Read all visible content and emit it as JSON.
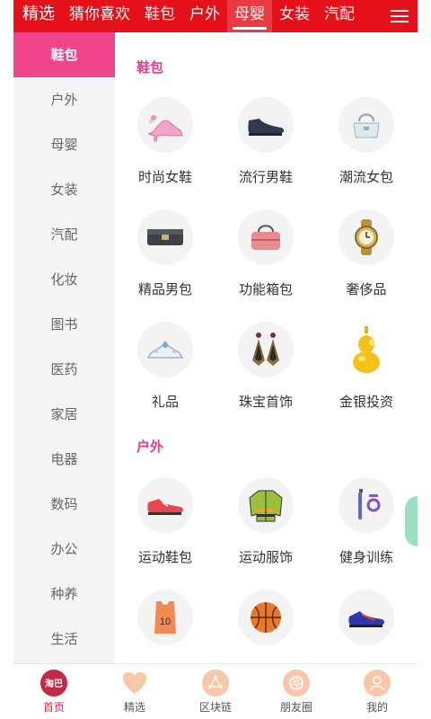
{
  "top_tabs": [
    "精选",
    "猜你喜欢",
    "鞋包",
    "户外",
    "母婴",
    "女装",
    "汽配"
  ],
  "active_tab": "母婴",
  "sidebar": [
    "鞋包",
    "户外",
    "母婴",
    "女装",
    "汽配",
    "化妆",
    "图书",
    "医药",
    "家居",
    "电器",
    "数码",
    "办公",
    "种养",
    "生活"
  ],
  "active_sidebar": "鞋包",
  "sections": [
    {
      "title": "鞋包",
      "items": [
        {
          "label": "时尚女鞋",
          "icon": "high-heel-icon"
        },
        {
          "label": "流行男鞋",
          "icon": "mens-shoe-icon"
        },
        {
          "label": "潮流女包",
          "icon": "handbag-icon"
        },
        {
          "label": "精品男包",
          "icon": "wallet-icon"
        },
        {
          "label": "功能箱包",
          "icon": "travel-bag-icon"
        },
        {
          "label": "奢侈品",
          "icon": "watch-icon"
        },
        {
          "label": "礼品",
          "icon": "tiara-icon"
        },
        {
          "label": "珠宝首饰",
          "icon": "earrings-icon"
        },
        {
          "label": "金银投资",
          "icon": "gold-ornament-icon"
        }
      ]
    },
    {
      "title": "户外",
      "items": [
        {
          "label": "运动鞋包",
          "icon": "sneaker-icon"
        },
        {
          "label": "运动服饰",
          "icon": "jacket-icon"
        },
        {
          "label": "健身训练",
          "icon": "fitness-icon"
        },
        {
          "label": "",
          "icon": "jersey-icon",
          "jersey_number": "10"
        },
        {
          "label": "",
          "icon": "basketball-icon"
        },
        {
          "label": "",
          "icon": "running-shoe-icon"
        }
      ]
    }
  ],
  "bottom_nav": [
    {
      "label": "首页",
      "icon": "home-logo-icon",
      "logo_text": "淘巴"
    },
    {
      "label": "精选",
      "icon": "heart-icon"
    },
    {
      "label": "区块链",
      "icon": "blockchain-icon"
    },
    {
      "label": "朋友圈",
      "icon": "camera-shutter-icon"
    },
    {
      "label": "我的",
      "icon": "user-icon"
    }
  ],
  "colors": {
    "topbar": "#e4101a",
    "sidebar_active": "#f0458c",
    "section_title": "#e03e8a",
    "tab_active": "#d32a4a"
  }
}
